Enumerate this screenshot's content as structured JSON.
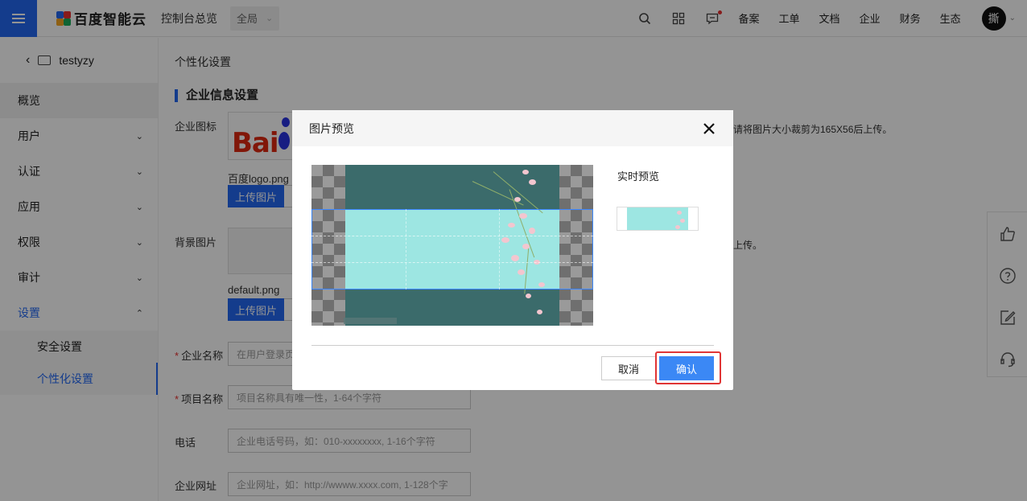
{
  "topbar": {
    "brand": "百度智能云",
    "console_title": "控制台总览",
    "region": "全局",
    "links": [
      "备案",
      "工单",
      "文档",
      "企业",
      "财务",
      "生态"
    ],
    "avatar_text": "撕"
  },
  "sidebar": {
    "account": "testyzy",
    "items": [
      {
        "label": "概览"
      },
      {
        "label": "用户"
      },
      {
        "label": "认证"
      },
      {
        "label": "应用"
      },
      {
        "label": "权限"
      },
      {
        "label": "审计"
      },
      {
        "label": "设置"
      }
    ],
    "sub_items": [
      {
        "label": "安全设置"
      },
      {
        "label": "个性化设置"
      }
    ]
  },
  "main": {
    "page_title": "个性化设置",
    "section_title": "企业信息设置",
    "logo_label": "企业图标",
    "logo_text": "Bai",
    "logo_file": "百度logo.png",
    "logo_hint": "请将图片大小裁剪为165X56后上传。",
    "upload_label": "上传图片",
    "bg_label": "背景图片",
    "bg_file": "default.png",
    "bg_hint": "上传。",
    "fields": [
      {
        "label": "企业名称",
        "required": true,
        "placeholder": "在用户登录页"
      },
      {
        "label": "项目名称",
        "required": true,
        "placeholder": "项目名称具有唯一性，1-64个字符"
      },
      {
        "label": "电话",
        "required": false,
        "placeholder": "企业电话号码，如：010-xxxxxxxx, 1-16个字符"
      },
      {
        "label": "企业网址",
        "required": false,
        "placeholder": "企业网址，如：http://wwww.xxxx.com, 1-128个字"
      }
    ],
    "required_mark": "*"
  },
  "dialog": {
    "title": "图片预览",
    "preview_label": "实时预览",
    "cancel_label": "取消",
    "ok_label": "确认"
  },
  "colors": {
    "primary": "#2468f2",
    "danger": "#e03535",
    "crop_fill": "#9de6e2",
    "photo_bg": "#3b6b6b"
  }
}
